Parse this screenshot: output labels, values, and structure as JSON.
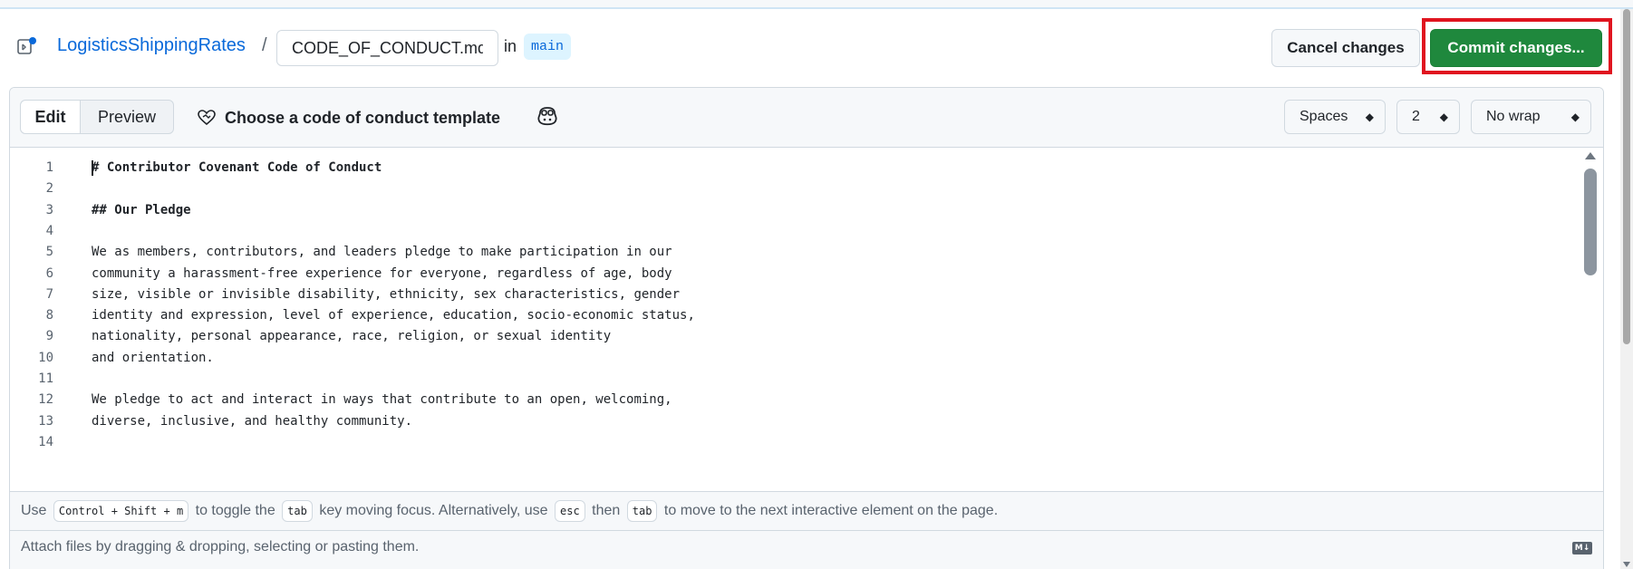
{
  "breadcrumb": {
    "repo": "LogisticsShippingRates",
    "separator": "/",
    "filename": "CODE_OF_CONDUCT.md",
    "in_label": "in",
    "branch": "main"
  },
  "actions": {
    "cancel_label": "Cancel changes",
    "commit_label": "Commit changes..."
  },
  "toolbar": {
    "edit_tab": "Edit",
    "preview_tab": "Preview",
    "template_label": "Choose a code of conduct template",
    "indent_mode": "Spaces",
    "indent_size": "2",
    "wrap_mode": "No wrap"
  },
  "code_lines": [
    {
      "n": "1",
      "text": "# Contributor Covenant Code of Conduct",
      "bold": true
    },
    {
      "n": "2",
      "text": "",
      "bold": false
    },
    {
      "n": "3",
      "text": "## Our Pledge",
      "bold": true
    },
    {
      "n": "4",
      "text": "",
      "bold": false
    },
    {
      "n": "5",
      "text": "We as members, contributors, and leaders pledge to make participation in our",
      "bold": false
    },
    {
      "n": "6",
      "text": "community a harassment-free experience for everyone, regardless of age, body",
      "bold": false
    },
    {
      "n": "7",
      "text": "size, visible or invisible disability, ethnicity, sex characteristics, gender",
      "bold": false
    },
    {
      "n": "8",
      "text": "identity and expression, level of experience, education, socio-economic status,",
      "bold": false
    },
    {
      "n": "9",
      "text": "nationality, personal appearance, race, religion, or sexual identity",
      "bold": false
    },
    {
      "n": "10",
      "text": "and orientation.",
      "bold": false
    },
    {
      "n": "11",
      "text": "",
      "bold": false
    },
    {
      "n": "12",
      "text": "We pledge to act and interact in ways that contribute to an open, welcoming,",
      "bold": false
    },
    {
      "n": "13",
      "text": "diverse, inclusive, and healthy community.",
      "bold": false
    },
    {
      "n": "14",
      "text": "",
      "bold": false
    }
  ],
  "help": {
    "use": "Use",
    "shortcut": "Control + Shift + m",
    "to_toggle": "to toggle the",
    "tab_key": "tab",
    "key_moving": "key moving focus. Alternatively, use",
    "esc_key": "esc",
    "then": "then",
    "tab_key2": "tab",
    "to_move": "to move to the next interactive element on the page."
  },
  "attach_text": "Attach files by dragging & dropping, selecting or pasting them.",
  "markdown_badge": "M↓",
  "colors": {
    "commit_green": "#1f883d",
    "link_blue": "#0969da",
    "highlight_red": "#e0141f"
  },
  "icons": {
    "file": "file-code-icon",
    "template": "heart-handshake-icon",
    "copilot": "copilot-icon",
    "markdown": "markdown-icon"
  }
}
